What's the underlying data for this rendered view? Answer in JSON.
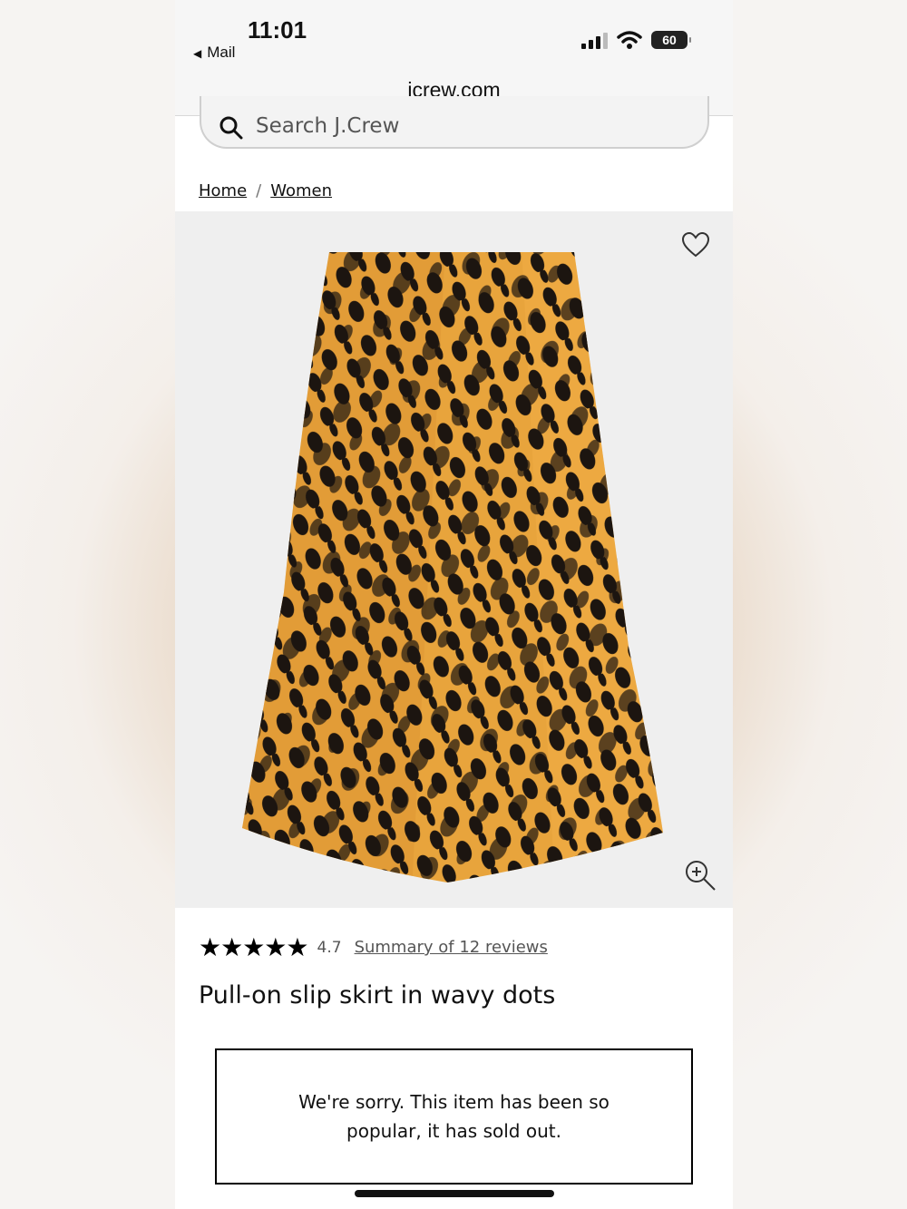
{
  "status_bar": {
    "time": "11:01",
    "back_app": "Mail",
    "battery": "60"
  },
  "browser": {
    "url": "jcrew.com"
  },
  "search": {
    "placeholder": "Search J.Crew"
  },
  "breadcrumb": {
    "items": [
      "Home",
      "Women"
    ],
    "separator": "/"
  },
  "product": {
    "image_description_icons": [
      "heart-icon",
      "zoom-in-icon"
    ],
    "stars": "★★★★★",
    "rating": "4.7",
    "reviews_link": "Summary of 12 reviews",
    "title": "Pull-on slip skirt in wavy dots",
    "sold_out_message": "We're sorry. This item has been so popular, it has sold out."
  },
  "colors": {
    "skirt_base": "#e8a43c",
    "skirt_dots": "#1c1510",
    "image_bg": "#efefef"
  }
}
